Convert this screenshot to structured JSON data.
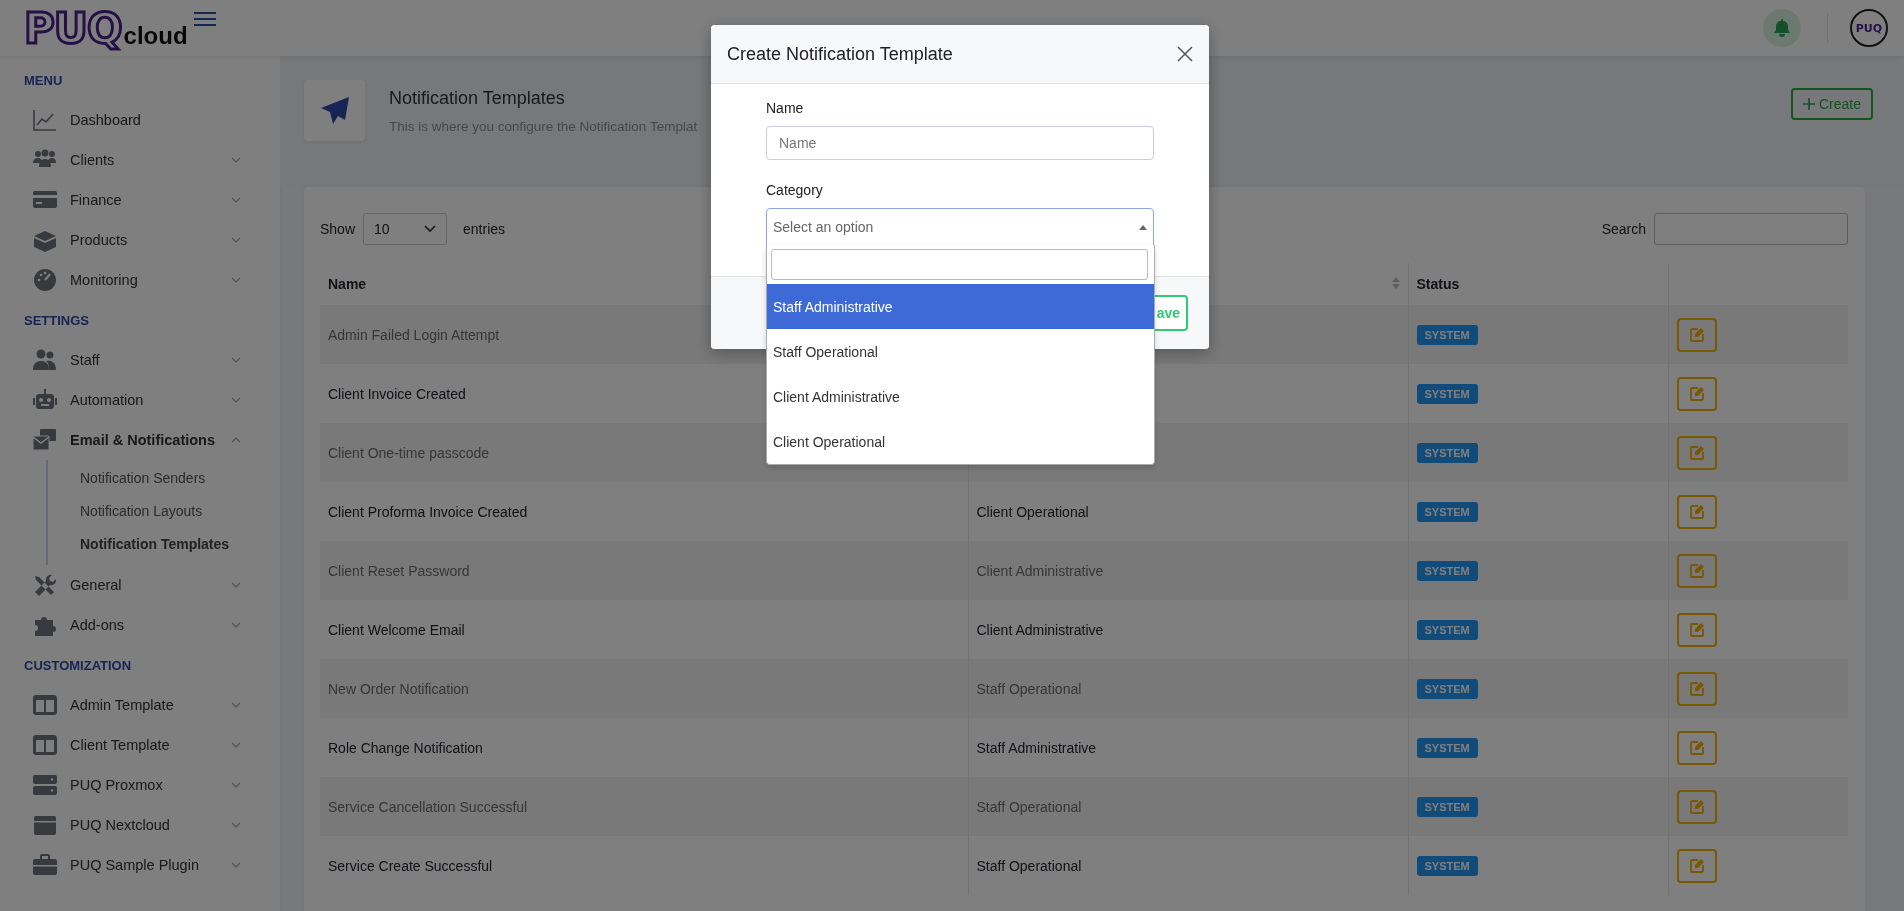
{
  "header": {
    "logo_main": "PUQ",
    "logo_sub": "cloud",
    "avatar_text": "PUQ"
  },
  "sidebar": {
    "sections": [
      {
        "title": "MENU",
        "items": [
          {
            "label": "Dashboard",
            "kind": "link"
          },
          {
            "label": "Clients",
            "kind": "group",
            "expanded": false
          },
          {
            "label": "Finance",
            "kind": "group",
            "expanded": false
          },
          {
            "label": "Products",
            "kind": "group",
            "expanded": false
          },
          {
            "label": "Monitoring",
            "kind": "group",
            "expanded": false
          }
        ]
      },
      {
        "title": "SETTINGS",
        "items": [
          {
            "label": "Staff",
            "kind": "group",
            "expanded": false
          },
          {
            "label": "Automation",
            "kind": "group",
            "expanded": false
          },
          {
            "label": "Email & Notifications",
            "kind": "group",
            "expanded": true,
            "children": [
              {
                "label": "Notification Senders",
                "selected": false
              },
              {
                "label": "Notification Layouts",
                "selected": false
              },
              {
                "label": "Notification Templates",
                "selected": true
              }
            ]
          },
          {
            "label": "General",
            "kind": "group",
            "expanded": false
          },
          {
            "label": "Add-ons",
            "kind": "group",
            "expanded": false
          }
        ]
      },
      {
        "title": "CUSTOMIZATION",
        "items": [
          {
            "label": "Admin Template",
            "kind": "group",
            "expanded": false
          },
          {
            "label": "Client Template",
            "kind": "group",
            "expanded": false
          },
          {
            "label": "PUQ Proxmox",
            "kind": "group",
            "expanded": false
          },
          {
            "label": "PUQ Nextcloud",
            "kind": "group",
            "expanded": false
          },
          {
            "label": "PUQ Sample Plugin",
            "kind": "group",
            "expanded": false
          }
        ]
      }
    ]
  },
  "page_header": {
    "title": "Notification Templates",
    "subtitle": "This is where you configure the Notification Templat",
    "create_button": "Create"
  },
  "table": {
    "show_label": "Show",
    "page_size": "10",
    "entries_label": "entries",
    "search_label": "Search",
    "columns": {
      "name": "Name",
      "status": "Status"
    },
    "rows": [
      {
        "name": "Admin Failed Login Attempt",
        "status": "SYSTEM"
      },
      {
        "name": "Client Invoice Created",
        "status": "SYSTEM"
      },
      {
        "name": "Client One-time passcode",
        "status": "SYSTEM"
      },
      {
        "name": "Client Proforma Invoice Created",
        "category": "Client Operational",
        "status": "SYSTEM"
      },
      {
        "name": "Client Reset Password",
        "category": "Client Administrative",
        "status": "SYSTEM"
      },
      {
        "name": "Client Welcome Email",
        "category": "Client Administrative",
        "status": "SYSTEM"
      },
      {
        "name": "New Order Notification",
        "category": "Staff Operational",
        "status": "SYSTEM"
      },
      {
        "name": "Role Change Notification",
        "category": "Staff Administrative",
        "status": "SYSTEM"
      },
      {
        "name": "Service Cancellation Successful",
        "category": "Staff Operational",
        "status": "SYSTEM"
      },
      {
        "name": "Service Create Successful",
        "category": "Staff Operational",
        "status": "SYSTEM"
      }
    ]
  },
  "modal": {
    "title": "Create Notification Template",
    "name_label": "Name",
    "name_placeholder": "Name",
    "category_label": "Category",
    "category_placeholder": "Select an option",
    "save_button": "ave",
    "dropdown": {
      "options": [
        {
          "label": "Staff Administrative",
          "selected": true
        },
        {
          "label": "Staff Operational",
          "selected": false
        },
        {
          "label": "Client Administrative",
          "selected": false
        },
        {
          "label": "Client Operational",
          "selected": false
        }
      ]
    }
  }
}
